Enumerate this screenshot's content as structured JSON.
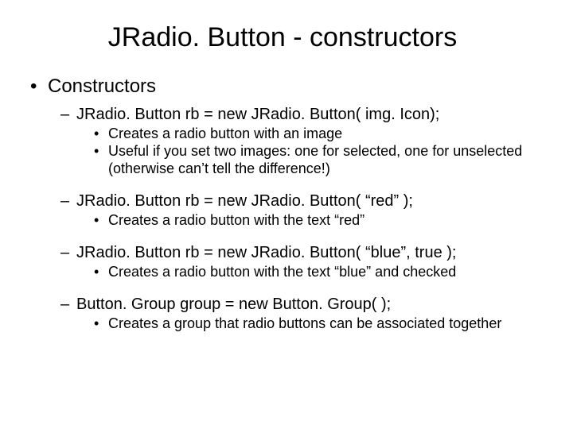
{
  "title": "JRadio. Button - constructors",
  "lvl1": {
    "label": "Constructors"
  },
  "groups": [
    {
      "head": "JRadio. Button rb = new JRadio. Button( img. Icon);",
      "subs": [
        "Creates a radio button with an image",
        "Useful if you set two images: one for selected, one for unselected (otherwise can’t tell the difference!)"
      ]
    },
    {
      "head": "JRadio. Button rb = new JRadio. Button( “red” );",
      "subs": [
        "Creates a radio button with the text “red”"
      ]
    },
    {
      "head": "JRadio. Button rb = new JRadio. Button( “blue”, true );",
      "subs": [
        "Creates a radio button with the text “blue” and checked"
      ]
    },
    {
      "head": "Button. Group group = new Button. Group( );",
      "subs": [
        "Creates a group that radio buttons can be associated together"
      ]
    }
  ]
}
